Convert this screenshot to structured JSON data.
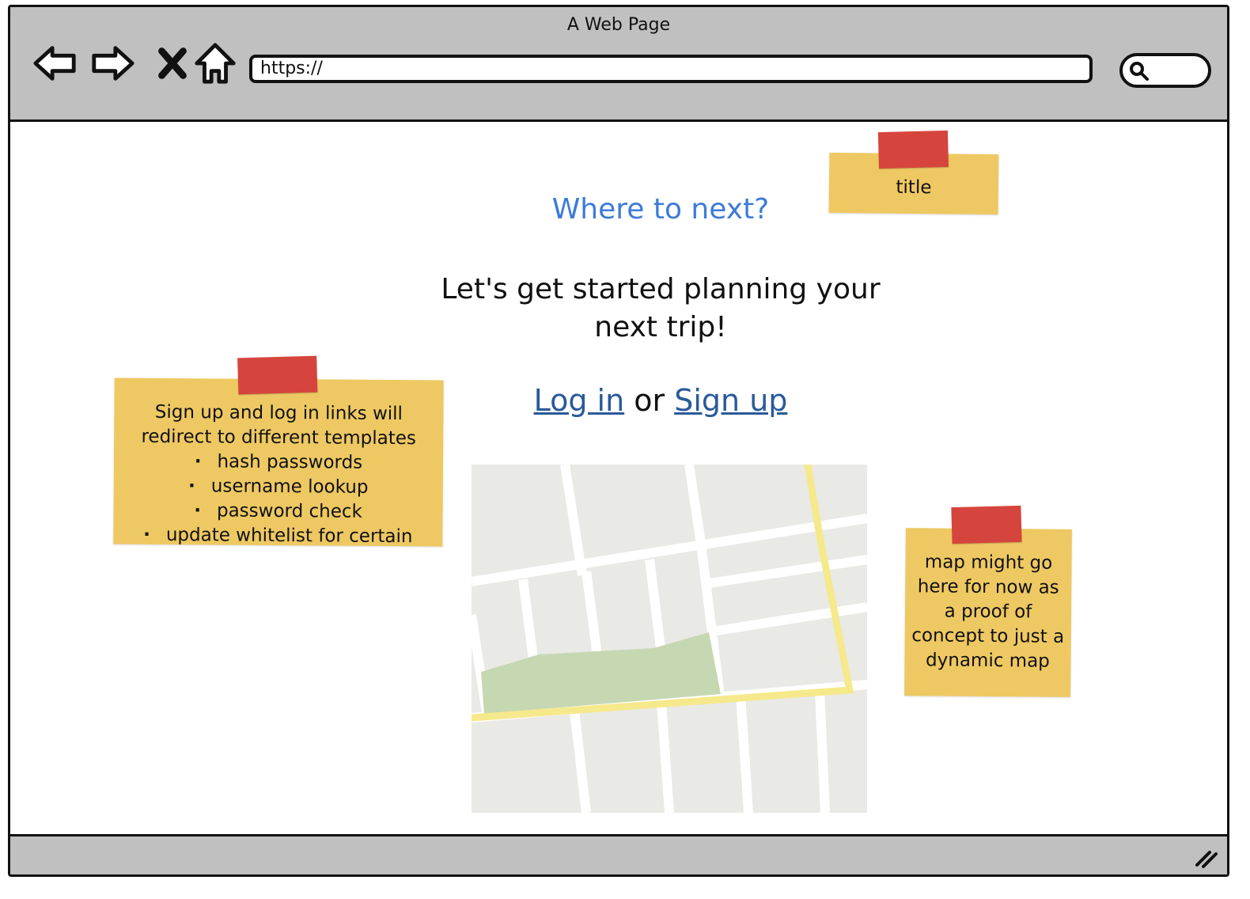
{
  "window": {
    "title": "A Web Page"
  },
  "toolbar": {
    "url_value": "https://",
    "icons": [
      "back-arrow-icon",
      "forward-arrow-icon",
      "stop-x-icon",
      "home-icon",
      "search-icon"
    ]
  },
  "page": {
    "heading": "Where to next?",
    "subheading_line1": "Let's get started planning your",
    "subheading_line2": "next trip!",
    "login_link": "Log in",
    "or_text": "or",
    "signup_link": "Sign up",
    "link_color": "#2a5a9a",
    "heading_color": "#3d7bd9"
  },
  "notes": {
    "title_note": "title",
    "auth_note": {
      "line1": "Sign up and log in links will",
      "line2": "redirect to different templates",
      "bullets": [
        "hash passwords",
        "username lookup",
        "password check",
        "update whitelist for certain"
      ]
    },
    "map_note": "map might go here for now as a proof of concept to just a dynamic map",
    "note_color": "#eec862",
    "tape_color": "#d6453d"
  }
}
